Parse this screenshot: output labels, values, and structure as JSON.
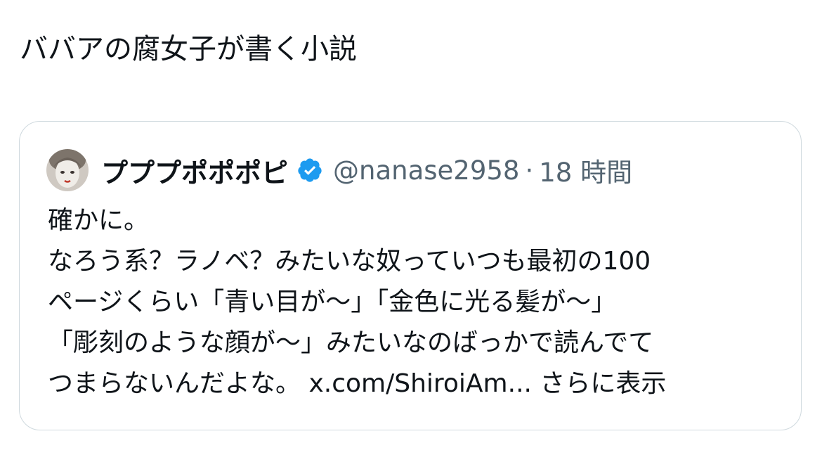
{
  "post": {
    "text": "ババアの腐女子が書く小説"
  },
  "quote": {
    "display_name": "プププポポポピ",
    "verified_icon": "verified-badge-icon",
    "verified_color": "#1d9bf0",
    "handle": "@nanase2958",
    "separator": "·",
    "timestamp": "18 時間",
    "lines": [
      "確かに。",
      "なろう系？ラノベ？みたいな奴っていつも最初の100",
      "ページくらい「青い目が〜」「金色に光る髪が〜」",
      "「彫刻のような顔が〜」みたいなのばっかで読んでて"
    ],
    "last_line_text": "つまらないんだよな。 ",
    "link": "x.com/ShiroiAm...",
    "show_more": "さらに表示"
  }
}
